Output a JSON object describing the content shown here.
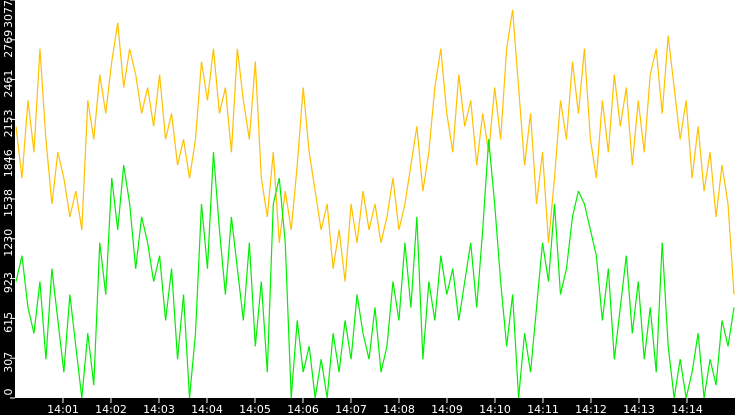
{
  "chart_data": {
    "type": "line",
    "title": "",
    "xlabel": "",
    "ylabel": "",
    "x_unit": "minutes after 14:00",
    "xlim": [
      0,
      15
    ],
    "ylim": [
      0,
      3077
    ],
    "grid": false,
    "y_ticks": [
      "0",
      "307",
      "615",
      "923",
      "1230",
      "1538",
      "1846",
      "2153",
      "2461",
      "2769",
      "3077"
    ],
    "x_ticks": [
      "14:01",
      "14:02",
      "14:03",
      "14:04",
      "14:05",
      "14:06",
      "14:07",
      "14:08",
      "14:09",
      "14:10",
      "14:11",
      "14:12",
      "14:13",
      "14:14"
    ],
    "colors": {
      "background": "#ffffff",
      "axis": "#000000",
      "axis_text": "#ffffff",
      "yellow": "#ffc000",
      "green": "#00ee00"
    },
    "series": [
      {
        "name": "yellow",
        "color": "#ffc000",
        "values": [
          2100,
          1700,
          2300,
          1900,
          2700,
          2000,
          1500,
          1900,
          1700,
          1400,
          1600,
          1300,
          2300,
          2000,
          2500,
          2200,
          2600,
          2900,
          2400,
          2700,
          2500,
          2200,
          2400,
          2100,
          2500,
          2000,
          2200,
          1800,
          2000,
          1700,
          2000,
          2600,
          2300,
          2700,
          2200,
          2400,
          1900,
          2700,
          2300,
          2000,
          2600,
          1700,
          1400,
          1900,
          1200,
          1600,
          1300,
          1800,
          2400,
          1900,
          1600,
          1300,
          1500,
          1000,
          1300,
          900,
          1500,
          1200,
          1600,
          1300,
          1500,
          1200,
          1400,
          1700,
          1300,
          1500,
          1800,
          2100,
          1600,
          1900,
          2400,
          2700,
          2200,
          1900,
          2500,
          2100,
          2300,
          1800,
          2200,
          1900,
          2400,
          2000,
          2700,
          3000,
          2400,
          1800,
          2200,
          1500,
          1900,
          1200,
          1700,
          2300,
          2000,
          2600,
          2200,
          2700,
          2000,
          1700,
          2300,
          1900,
          2500,
          2100,
          2400,
          1800,
          2300,
          1900,
          2500,
          2700,
          2200,
          2800,
          2400,
          2000,
          2300,
          1700,
          2100,
          1600,
          1900,
          1400,
          1800,
          1500,
          800
        ]
      },
      {
        "name": "green",
        "color": "#00ee00",
        "values": [
          900,
          1100,
          700,
          500,
          900,
          300,
          1000,
          600,
          200,
          800,
          400,
          0,
          500,
          100,
          1200,
          800,
          1700,
          1300,
          1800,
          1500,
          1000,
          1400,
          1200,
          900,
          1100,
          600,
          1000,
          300,
          800,
          0,
          500,
          1500,
          1000,
          1900,
          1300,
          800,
          1400,
          1000,
          600,
          1200,
          400,
          900,
          200,
          1500,
          1700,
          1200,
          0,
          600,
          200,
          400,
          0,
          300,
          0,
          500,
          200,
          600,
          300,
          800,
          500,
          300,
          700,
          200,
          400,
          900,
          600,
          1200,
          700,
          1400,
          300,
          900,
          600,
          1100,
          800,
          1000,
          600,
          900,
          1200,
          700,
          1300,
          2000,
          1500,
          900,
          400,
          800,
          0,
          500,
          200,
          700,
          1200,
          900,
          1500,
          800,
          1000,
          1400,
          1600,
          1500,
          1300,
          1100,
          600,
          1000,
          300,
          700,
          1100,
          500,
          900,
          300,
          700,
          200,
          1200,
          400,
          0,
          300,
          0,
          200,
          500,
          0,
          300,
          100,
          600,
          400,
          700
        ]
      }
    ]
  }
}
